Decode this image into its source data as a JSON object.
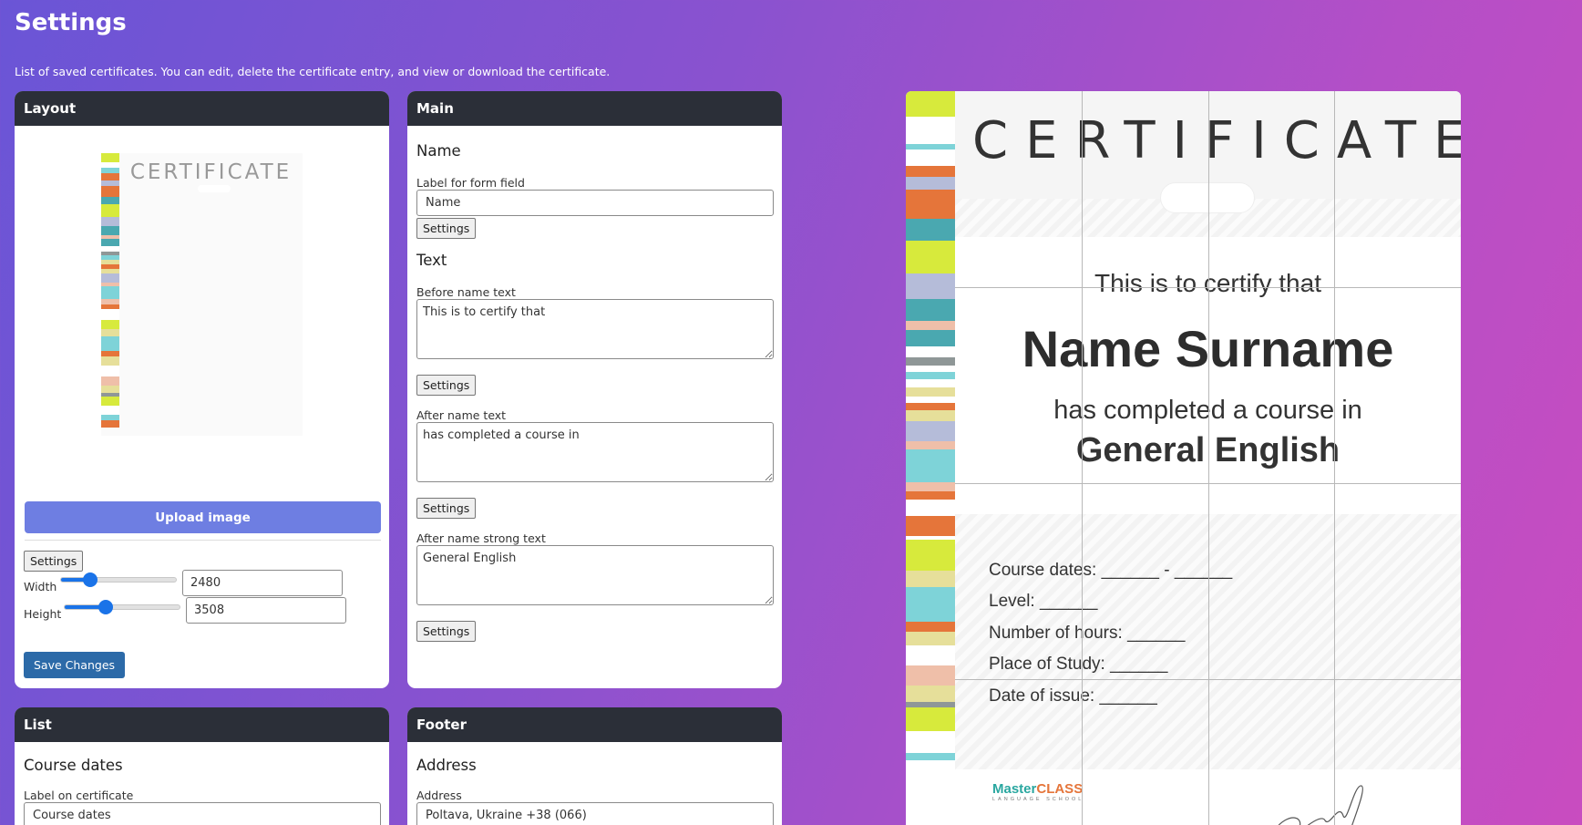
{
  "header": {
    "title": "Settings",
    "description": "List of saved certificates. You can edit, delete the certificate entry, and view or download the certificate."
  },
  "layout_card": {
    "title": "Layout",
    "thumbnail_title": "CERTIFICATE",
    "upload_label": "Upload image",
    "settings_label": "Settings",
    "width_label": "Width",
    "width_value": "2480",
    "width_slider": 0.25,
    "height_label": "Height",
    "height_value": "3508",
    "height_slider": 0.36,
    "save_label": "Save Changes"
  },
  "main_card": {
    "title": "Main",
    "name_section": "Name",
    "name_field_label": "Label for form field",
    "name_field_value": "Name",
    "text_section": "Text",
    "before_label": "Before name text",
    "before_value": "This is to certify that",
    "after_label": "After name text",
    "after_value": "has completed a course in",
    "strong_label": "After name strong text",
    "strong_value": "General English",
    "settings_label": "Settings"
  },
  "list_card": {
    "title": "List",
    "section": "Course dates",
    "field_label": "Label on certificate",
    "field_value": "Course dates"
  },
  "footer_card": {
    "title": "Footer",
    "section": "Address",
    "field_label": "Address",
    "field_value": "Poltava, Ukraine +38 (066)"
  },
  "certificate": {
    "title": "CERTIFICATE",
    "intro": "This is to certify that",
    "name": "Name Surname",
    "after": "has completed a course in",
    "course": "General English",
    "lines": [
      "Course dates: ______ - ______",
      "Level: ______",
      "Number of hours: ______",
      "Place of Study: ______",
      "Date of issue: ______"
    ],
    "logo_a": "Master",
    "logo_b": "CLASS",
    "logo_sub": "LANGUAGE SCHOOL"
  },
  "colors": {
    "stripe_lime": "#d7ea3c",
    "stripe_orange": "#e5753a",
    "stripe_teal": "#4aa8b0",
    "stripe_cyan": "#7ed3d8",
    "stripe_lavender": "#b5bcd9",
    "stripe_peach": "#efbfa9",
    "stripe_sand": "#e6df9a",
    "stripe_gray": "#8f9797",
    "accent_blue": "#6e7ee2",
    "save_blue": "#2c6aa8"
  }
}
